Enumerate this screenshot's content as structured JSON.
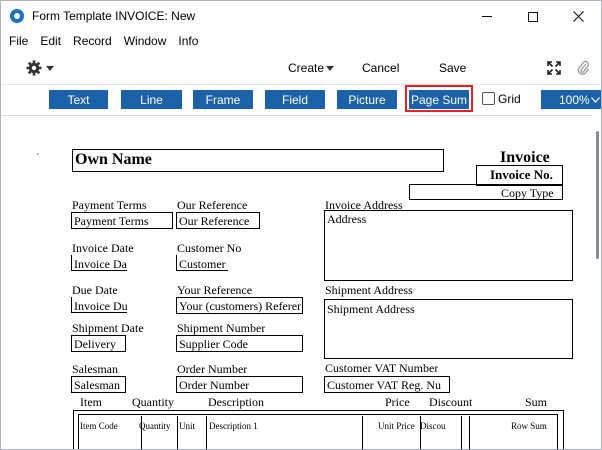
{
  "window": {
    "title": "Form Template INVOICE: New",
    "minimize_icon": "minimize-icon",
    "maximize_icon": "maximize-icon",
    "close_icon": "close-icon"
  },
  "menu": [
    "File",
    "Edit",
    "Record",
    "Window",
    "Info"
  ],
  "toolbar": {
    "create": "Create",
    "cancel": "Cancel",
    "save": "Save"
  },
  "tools": {
    "text": "Text",
    "line": "Line",
    "frame": "Frame",
    "field": "Field",
    "picture": "Picture",
    "page_sum": "Page Sum",
    "grid": "Grid",
    "zoom": "100%"
  },
  "colors": {
    "tool_button_bg": "#1b62a8",
    "highlight_outline": "#e32026"
  },
  "form": {
    "own_name": "Own Name",
    "invoice_title": "Invoice",
    "invoice_no": "Invoice No.",
    "copy_type": "Copy Type",
    "payment_terms_label": "Payment Terms",
    "payment_terms_field": "Payment Terms",
    "our_reference_label": "Our Reference",
    "our_reference_field": "Our Reference",
    "invoice_address_label": "Invoice Address",
    "invoice_address_field": "Address",
    "invoice_date_label": "Invoice Date",
    "invoice_date_field": "Invoice Da",
    "customer_no_label": "Customer No",
    "customer_no_field": "Customer",
    "due_date_label": "Due Date",
    "due_date_field": "Invoice Du",
    "your_reference_label": "Your Reference",
    "your_reference_field": "Your (customers) Referen",
    "shipment_address_label": "Shipment Address",
    "shipment_address_field": "Shipment Address",
    "shipment_date_label": "Shipment Date",
    "shipment_date_field": "Delivery",
    "shipment_number_label": "Shipment Number",
    "shipment_number_field": "Supplier Code",
    "salesman_label": "Salesman",
    "salesman_field": "Salesman",
    "order_number_label": "Order Number",
    "order_number_field": "Order Number",
    "customer_vat_label": "Customer VAT Number",
    "customer_vat_field": "Customer VAT Reg. Nu",
    "col_item": "Item",
    "col_quantity": "Quantity",
    "col_description": "Description",
    "col_price": "Price",
    "col_discount": "Discount",
    "col_sum": "Sum",
    "row_item_code": "Item Code",
    "row_quantity": "Quantity",
    "row_unit": "Unit",
    "row_description": "Description 1",
    "row_unit_price": "Unit Price",
    "row_discount": "Discou",
    "row_sum": "Row Sum"
  }
}
